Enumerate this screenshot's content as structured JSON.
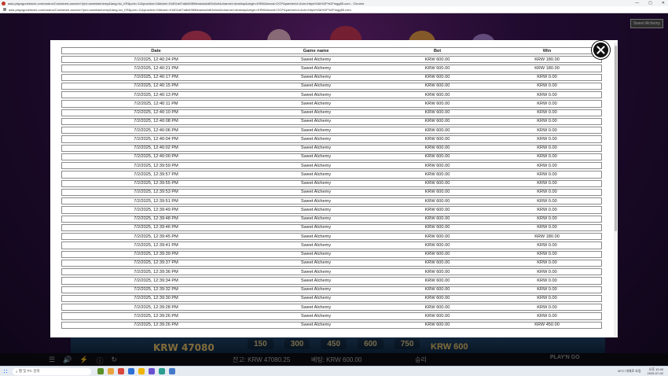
{
  "browser": {
    "title": "asia.playngonetwork.com/casino/ContainerLauncher?pid=sweetalchemy&lang=ko_KR&pctx=11&practice=0&ticket=01801a97a8d4989bbaeda4d63d4cb&channel=desktop&origin=KRW&brand=OCP&partnerId=&ctx=https%3A%2F%2Fmgg55.com - Chrome",
    "url": "asia.playngonetwork.com/casino/ContainerLauncher?pid=sweetalchemy&lang=ko_KR&pctx=11&practice=0&ticket=01801a97a8d4989bbaeda4d63d4cb&channel=desktop&origin=KRW&brand=OCP&partnerId=&ctx=https%3A%2F%2Fmgg55.com",
    "controls": {
      "minimize": "—",
      "maximize": "▢",
      "close": "✕"
    }
  },
  "game": {
    "badge": "Sweet Alchemy",
    "krw_left": "KRW 47080",
    "chips": [
      "150",
      "300",
      "450",
      "600",
      "750"
    ],
    "krw_right": "KRW 600",
    "balance": "잔고: KRW 47080.25",
    "bet": "베팅: KRW 600.00",
    "win": "승리",
    "provider": "PLAY'N GO"
  },
  "history": {
    "columns": [
      "Date",
      "Game name",
      "Bet",
      "Win"
    ],
    "rows": [
      [
        "7/2/2025, 12:40:24 PM",
        "Sweet Alchemy",
        "KRW 600.00",
        "KRW 180.00"
      ],
      [
        "7/2/2025, 12:40:21 PM",
        "Sweet Alchemy",
        "KRW 600.00",
        "KRW 180.00"
      ],
      [
        "7/2/2025, 12:40:17 PM",
        "Sweet Alchemy",
        "KRW 600.00",
        "KRW 0.00"
      ],
      [
        "7/2/2025, 12:40:15 PM",
        "Sweet Alchemy",
        "KRW 600.00",
        "KRW 0.00"
      ],
      [
        "7/2/2025, 12:40:13 PM",
        "Sweet Alchemy",
        "KRW 600.00",
        "KRW 0.00"
      ],
      [
        "7/2/2025, 12:40:11 PM",
        "Sweet Alchemy",
        "KRW 600.00",
        "KRW 0.00"
      ],
      [
        "7/2/2025, 12:40:10 PM",
        "Sweet Alchemy",
        "KRW 600.00",
        "KRW 0.00"
      ],
      [
        "7/2/2025, 12:40:08 PM",
        "Sweet Alchemy",
        "KRW 600.00",
        "KRW 0.00"
      ],
      [
        "7/2/2025, 12:40:06 PM",
        "Sweet Alchemy",
        "KRW 600.00",
        "KRW 0.00"
      ],
      [
        "7/2/2025, 12:40:04 PM",
        "Sweet Alchemy",
        "KRW 600.00",
        "KRW 0.00"
      ],
      [
        "7/2/2025, 12:40:02 PM",
        "Sweet Alchemy",
        "KRW 600.00",
        "KRW 0.00"
      ],
      [
        "7/2/2025, 12:40:00 PM",
        "Sweet Alchemy",
        "KRW 600.00",
        "KRW 0.00"
      ],
      [
        "7/2/2025, 12:39:59 PM",
        "Sweet Alchemy",
        "KRW 600.00",
        "KRW 0.00"
      ],
      [
        "7/2/2025, 12:39:57 PM",
        "Sweet Alchemy",
        "KRW 600.00",
        "KRW 0.00"
      ],
      [
        "7/2/2025, 12:39:55 PM",
        "Sweet Alchemy",
        "KRW 600.00",
        "KRW 0.00"
      ],
      [
        "7/2/2025, 12:39:53 PM",
        "Sweet Alchemy",
        "KRW 600.00",
        "KRW 0.00"
      ],
      [
        "7/2/2025, 12:39:51 PM",
        "Sweet Alchemy",
        "KRW 600.00",
        "KRW 0.00"
      ],
      [
        "7/2/2025, 12:39:49 PM",
        "Sweet Alchemy",
        "KRW 600.00",
        "KRW 0.00"
      ],
      [
        "7/2/2025, 12:39:48 PM",
        "Sweet Alchemy",
        "KRW 600.00",
        "KRW 0.00"
      ],
      [
        "7/2/2025, 12:39:46 PM",
        "Sweet Alchemy",
        "KRW 600.00",
        "KRW 0.00"
      ],
      [
        "7/2/2025, 12:39:45 PM",
        "Sweet Alchemy",
        "KRW 600.00",
        "KRW 180.00"
      ],
      [
        "7/2/2025, 12:39:41 PM",
        "Sweet Alchemy",
        "KRW 600.00",
        "KRW 0.00"
      ],
      [
        "7/2/2025, 12:39:39 PM",
        "Sweet Alchemy",
        "KRW 600.00",
        "KRW 0.00"
      ],
      [
        "7/2/2025, 12:39:37 PM",
        "Sweet Alchemy",
        "KRW 600.00",
        "KRW 0.00"
      ],
      [
        "7/2/2025, 12:39:36 PM",
        "Sweet Alchemy",
        "KRW 600.00",
        "KRW 0.00"
      ],
      [
        "7/2/2025, 12:39:34 PM",
        "Sweet Alchemy",
        "KRW 600.00",
        "KRW 0.00"
      ],
      [
        "7/2/2025, 12:39:32 PM",
        "Sweet Alchemy",
        "KRW 600.00",
        "KRW 0.00"
      ],
      [
        "7/2/2025, 12:39:30 PM",
        "Sweet Alchemy",
        "KRW 600.00",
        "KRW 0.00"
      ],
      [
        "7/2/2025, 12:39:28 PM",
        "Sweet Alchemy",
        "KRW 600.00",
        "KRW 0.00"
      ],
      [
        "7/2/2025, 12:39:26 PM",
        "Sweet Alchemy",
        "KRW 600.00",
        "KRW 0.00"
      ],
      [
        "7/2/2025, 12:39:26 PM",
        "Sweet Alchemy",
        "KRW 600.00",
        "KRW 450.00"
      ]
    ]
  },
  "taskbar": {
    "search_placeholder": "웹 및 PC 검색",
    "weather": "30°C 대체로 흐림",
    "time": "오후 12:40",
    "date": "2025-07-02",
    "app_colors": [
      "#5a8f29",
      "#e8a33d",
      "#d9483b",
      "#2b6fd6",
      "#f0b400",
      "#6a4fd1",
      "#2a9d8f",
      "#4479c9"
    ]
  },
  "colors": {
    "modal_bg": "#ffffff",
    "close_bg": "#111111",
    "accent_gold": "#e9c46a"
  }
}
